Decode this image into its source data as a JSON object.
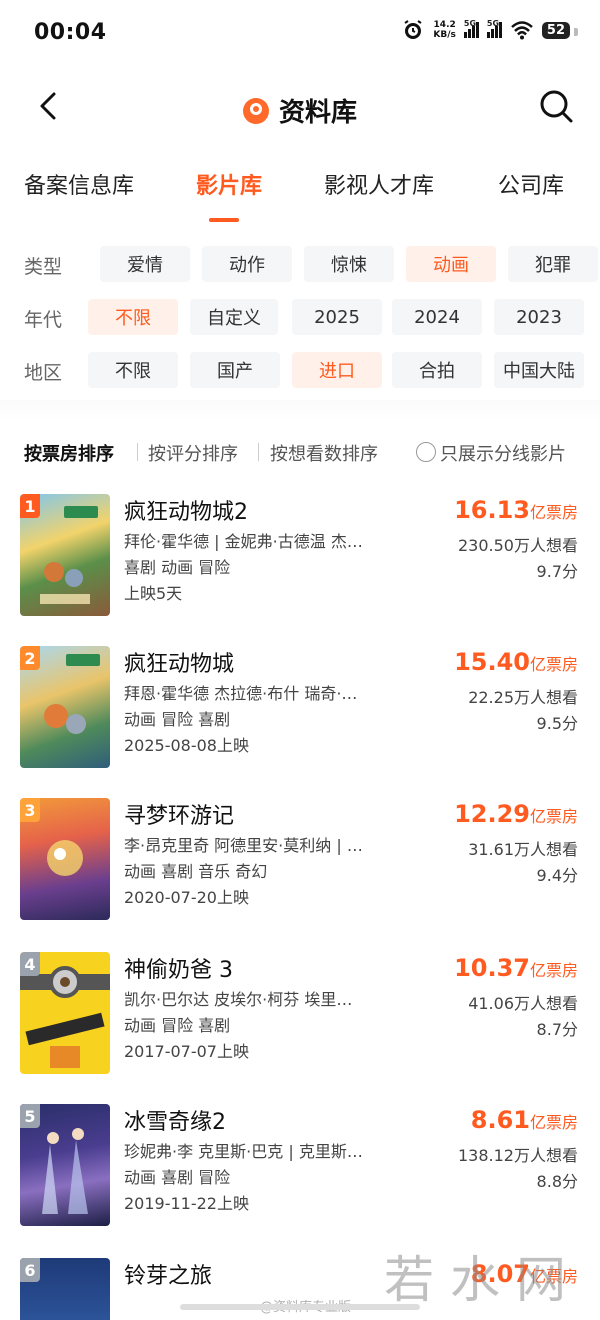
{
  "status_bar": {
    "time": "00:04",
    "net_speed": "14.2",
    "net_unit": "KB/s",
    "sig1": "5G",
    "sig2": "5G",
    "battery": "52"
  },
  "header": {
    "title": "资料库"
  },
  "category_tabs": [
    "备案信息库",
    "影片库",
    "影视人才库",
    "公司库"
  ],
  "filters": {
    "type": {
      "label": "类型",
      "options": [
        "爱情",
        "动作",
        "惊悚",
        "动画",
        "犯罪"
      ],
      "selected": "动画"
    },
    "era": {
      "label": "年代",
      "options": [
        "不限",
        "自定义",
        "2025",
        "2024",
        "2023"
      ],
      "selected": "不限"
    },
    "region": {
      "label": "地区",
      "options": [
        "不限",
        "国产",
        "进口",
        "合拍",
        "中国大陆"
      ],
      "selected": "进口"
    }
  },
  "sort": {
    "options": [
      "按票房排序",
      "按评分排序",
      "按想看数排序"
    ],
    "active": "按票房排序",
    "toggle_label": "只展示分线影片"
  },
  "box_unit": "亿票房",
  "movies": [
    {
      "rank": "1",
      "title": "疯狂动物城2",
      "cast": "拜伦·霍华德 | 金妮弗·古德温 杰…",
      "tags": "喜剧 动画 冒险",
      "date": "上映5天",
      "box": "16.13",
      "want": "230.50万人想看",
      "score": "9.7分"
    },
    {
      "rank": "2",
      "title": "疯狂动物城",
      "cast": "拜恩·霍华德 杰拉德·布什 瑞奇·…",
      "tags": "动画 冒险 喜剧",
      "date": "2025-08-08上映",
      "box": "15.40",
      "want": "22.25万人想看",
      "score": "9.5分"
    },
    {
      "rank": "3",
      "title": "寻梦环游记",
      "cast": "李·昂克里奇 阿德里安·莫利纳 | …",
      "tags": "动画 喜剧 音乐 奇幻",
      "date": "2020-07-20上映",
      "box": "12.29",
      "want": "31.61万人想看",
      "score": "9.4分"
    },
    {
      "rank": "4",
      "title": "神偷奶爸 3",
      "cast": "凯尔·巴尔达 皮埃尔·柯芬 埃里…",
      "tags": "动画 冒险 喜剧",
      "date": "2017-07-07上映",
      "box": "10.37",
      "want": "41.06万人想看",
      "score": "8.7分"
    },
    {
      "rank": "5",
      "title": "冰雪奇缘2",
      "cast": "珍妮弗·李 克里斯·巴克 | 克里斯…",
      "tags": "动画 喜剧 冒险",
      "date": "2019-11-22上映",
      "box": "8.61",
      "want": "138.12万人想看",
      "score": "8.8分"
    },
    {
      "rank": "6",
      "title": "铃芽之旅",
      "cast": "",
      "tags": "",
      "date": "",
      "box": "8.07",
      "want": "",
      "score": ""
    }
  ],
  "colors": {
    "accent": "#ff5a1f",
    "chip_active_bg": "#fff1ea",
    "chip_bg": "#f5f6f8",
    "rank1": "#ff5a1f",
    "rank2": "#ff8a2b",
    "rank3": "#ffa23a",
    "rank_other": "#9aa3ad"
  },
  "watermark": "若水网",
  "watermark_small": "@资料库专业版"
}
